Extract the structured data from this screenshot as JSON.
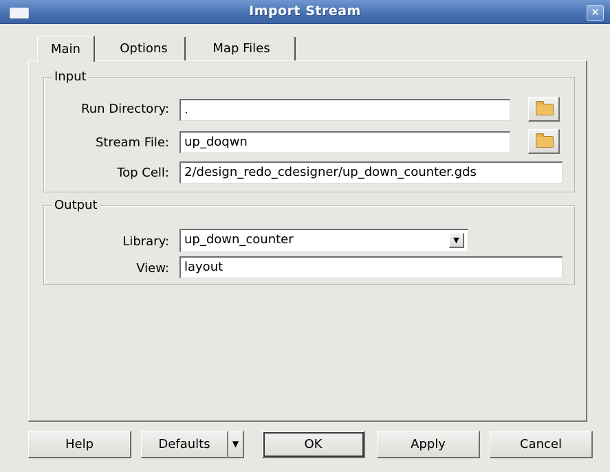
{
  "window": {
    "title": "Import Stream",
    "close_glyph": "✕"
  },
  "tabs": [
    {
      "label": "Main",
      "active": true
    },
    {
      "label": "Options",
      "active": false
    },
    {
      "label": "Map Files",
      "active": false
    }
  ],
  "input_group": {
    "title": "Input",
    "run_directory": {
      "label": "Run Directory:",
      "value": "."
    },
    "stream_file": {
      "label": "Stream File:",
      "value": "up_doqwn"
    },
    "top_cell": {
      "label": "Top Cell:",
      "value": "2/design_redo_cdesigner/up_down_counter.gds"
    },
    "browse_icon": "folder-icon"
  },
  "output_group": {
    "title": "Output",
    "library": {
      "label": "Library:",
      "value": "up_down_counter"
    },
    "view": {
      "label": "View:",
      "value": "layout"
    }
  },
  "buttons": {
    "help": "Help",
    "defaults": "Defaults",
    "ok": "OK",
    "apply": "Apply",
    "cancel": "Cancel",
    "dropdown_glyph": "▼"
  },
  "colors": {
    "titlebar": "#4a73b4",
    "window_bg": "#e9e7e3"
  }
}
